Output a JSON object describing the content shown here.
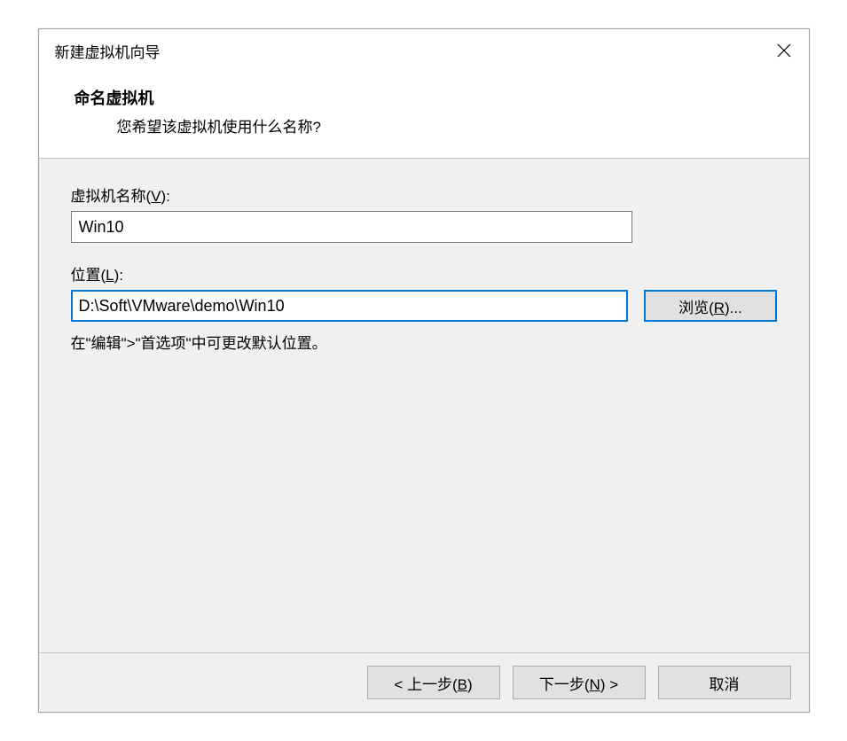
{
  "titlebar": {
    "title": "新建虚拟机向导"
  },
  "header": {
    "title": "命名虚拟机",
    "subtitle": "您希望该虚拟机使用什么名称?"
  },
  "fields": {
    "name": {
      "label_prefix": "虚拟机名称(",
      "label_key": "V",
      "label_suffix": "):",
      "value": "Win10"
    },
    "location": {
      "label_prefix": "位置(",
      "label_key": "L",
      "label_suffix": "):",
      "value": "D:\\Soft\\VMware\\demo\\Win10",
      "browse_prefix": "浏览(",
      "browse_key": "R",
      "browse_suffix": ")..."
    },
    "hint": "在\"编辑\">\"首选项\"中可更改默认位置。"
  },
  "footer": {
    "back_prefix": "< 上一步(",
    "back_key": "B",
    "back_suffix": ")",
    "next_prefix": "下一步(",
    "next_key": "N",
    "next_suffix": ") >",
    "cancel": "取消"
  }
}
